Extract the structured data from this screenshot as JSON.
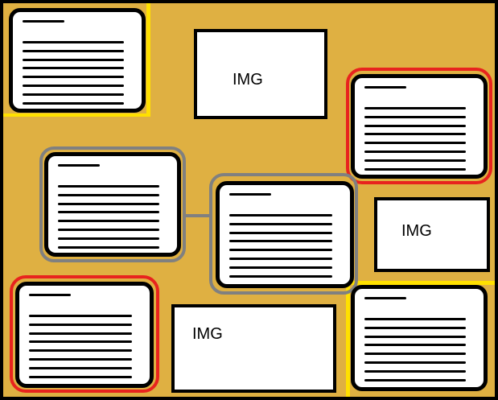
{
  "colors": {
    "background": "#dfb042",
    "outline": "#000000",
    "card_fill": "#ffffff",
    "group_gray": "#808080",
    "highlight_red": "#e8231e",
    "highlight_yellow": "#ffe000"
  },
  "image_placeholders": {
    "top_center": {
      "label": "IMG"
    },
    "right_middle": {
      "label": "IMG"
    },
    "bottom_center": {
      "label": "IMG"
    }
  },
  "text_cards": {
    "top_left": {
      "highlight": "yellow-corner"
    },
    "top_right": {
      "highlight": "red"
    },
    "middle_left": {
      "highlight": "gray"
    },
    "middle_center": {
      "highlight": "gray"
    },
    "bottom_left": {
      "highlight": "red"
    },
    "bottom_right": {
      "highlight": "yellow-corner"
    }
  },
  "connector": {
    "from": "middle_left",
    "to": "middle_center",
    "color": "gray"
  }
}
